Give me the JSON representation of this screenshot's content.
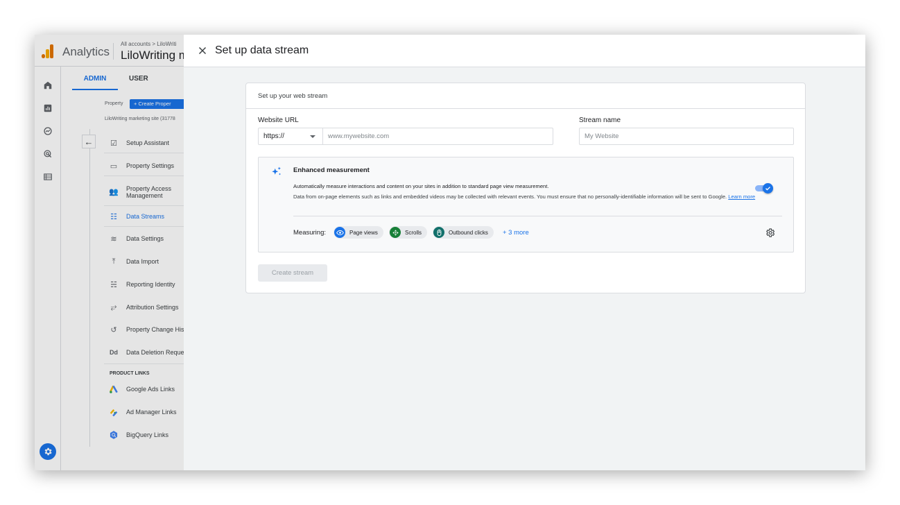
{
  "app": {
    "product_name": "Analytics",
    "account_breadcrumb": "All accounts > LiloWriti",
    "property_title": "LiloWriting m"
  },
  "tabs": {
    "admin": "ADMIN",
    "user": "USER"
  },
  "property_panel": {
    "property_label": "Property",
    "create_property_label": "+ Create Proper",
    "site_name": "LiloWriting marketing site (31778",
    "items": [
      {
        "label": "Setup Assistant",
        "icon": "checkbox-icon"
      },
      {
        "label": "Property Settings",
        "icon": "settings-square-icon"
      },
      {
        "label": "Property Access Management",
        "icon": "people-icon"
      },
      {
        "label": "Data Streams",
        "icon": "data-streams-icon",
        "active": true
      },
      {
        "label": "Data Settings",
        "icon": "database-icon"
      },
      {
        "label": "Data Import",
        "icon": "upload-icon"
      },
      {
        "label": "Reporting Identity",
        "icon": "identity-icon"
      },
      {
        "label": "Attribution Settings",
        "icon": "attribution-icon"
      },
      {
        "label": "Property Change His",
        "icon": "history-icon"
      },
      {
        "label": "Data Deletion Reque",
        "icon": "dd-icon"
      }
    ],
    "product_links_heading": "PRODUCT LINKS",
    "product_links": [
      {
        "label": "Google Ads Links",
        "icon": "google-ads-icon"
      },
      {
        "label": "Ad Manager Links",
        "icon": "ad-manager-icon"
      },
      {
        "label": "BigQuery Links",
        "icon": "bigquery-icon"
      }
    ]
  },
  "panel": {
    "title": "Set up data stream",
    "card_heading": "Set up your web stream",
    "website_url_label": "Website URL",
    "protocol_value": "https://",
    "url_placeholder": "www.mywebsite.com",
    "stream_name_label": "Stream name",
    "stream_name_placeholder": "My Website",
    "enhanced": {
      "title": "Enhanced measurement",
      "description_1": "Automatically measure interactions and content on your sites in addition to standard page view measurement.",
      "description_2": "Data from on-page elements such as links and embedded videos may be collected with relevant events. You must ensure that no personally-identifiable information will be sent to Google.",
      "learn_more": "Learn more",
      "toggle_on": true,
      "measuring_label": "Measuring:",
      "chips": [
        {
          "label": "Page views",
          "color": "#1a73e8",
          "icon": "eye-icon"
        },
        {
          "label": "Scrolls",
          "color": "#188038",
          "icon": "scroll-icon"
        },
        {
          "label": "Outbound clicks",
          "color": "#12706b",
          "icon": "mouse-icon"
        }
      ],
      "more": "+ 3 more"
    },
    "create_button": "Create stream"
  },
  "colors": {
    "accent": "#1a73e8",
    "panel_bg": "#f1f3f4"
  }
}
